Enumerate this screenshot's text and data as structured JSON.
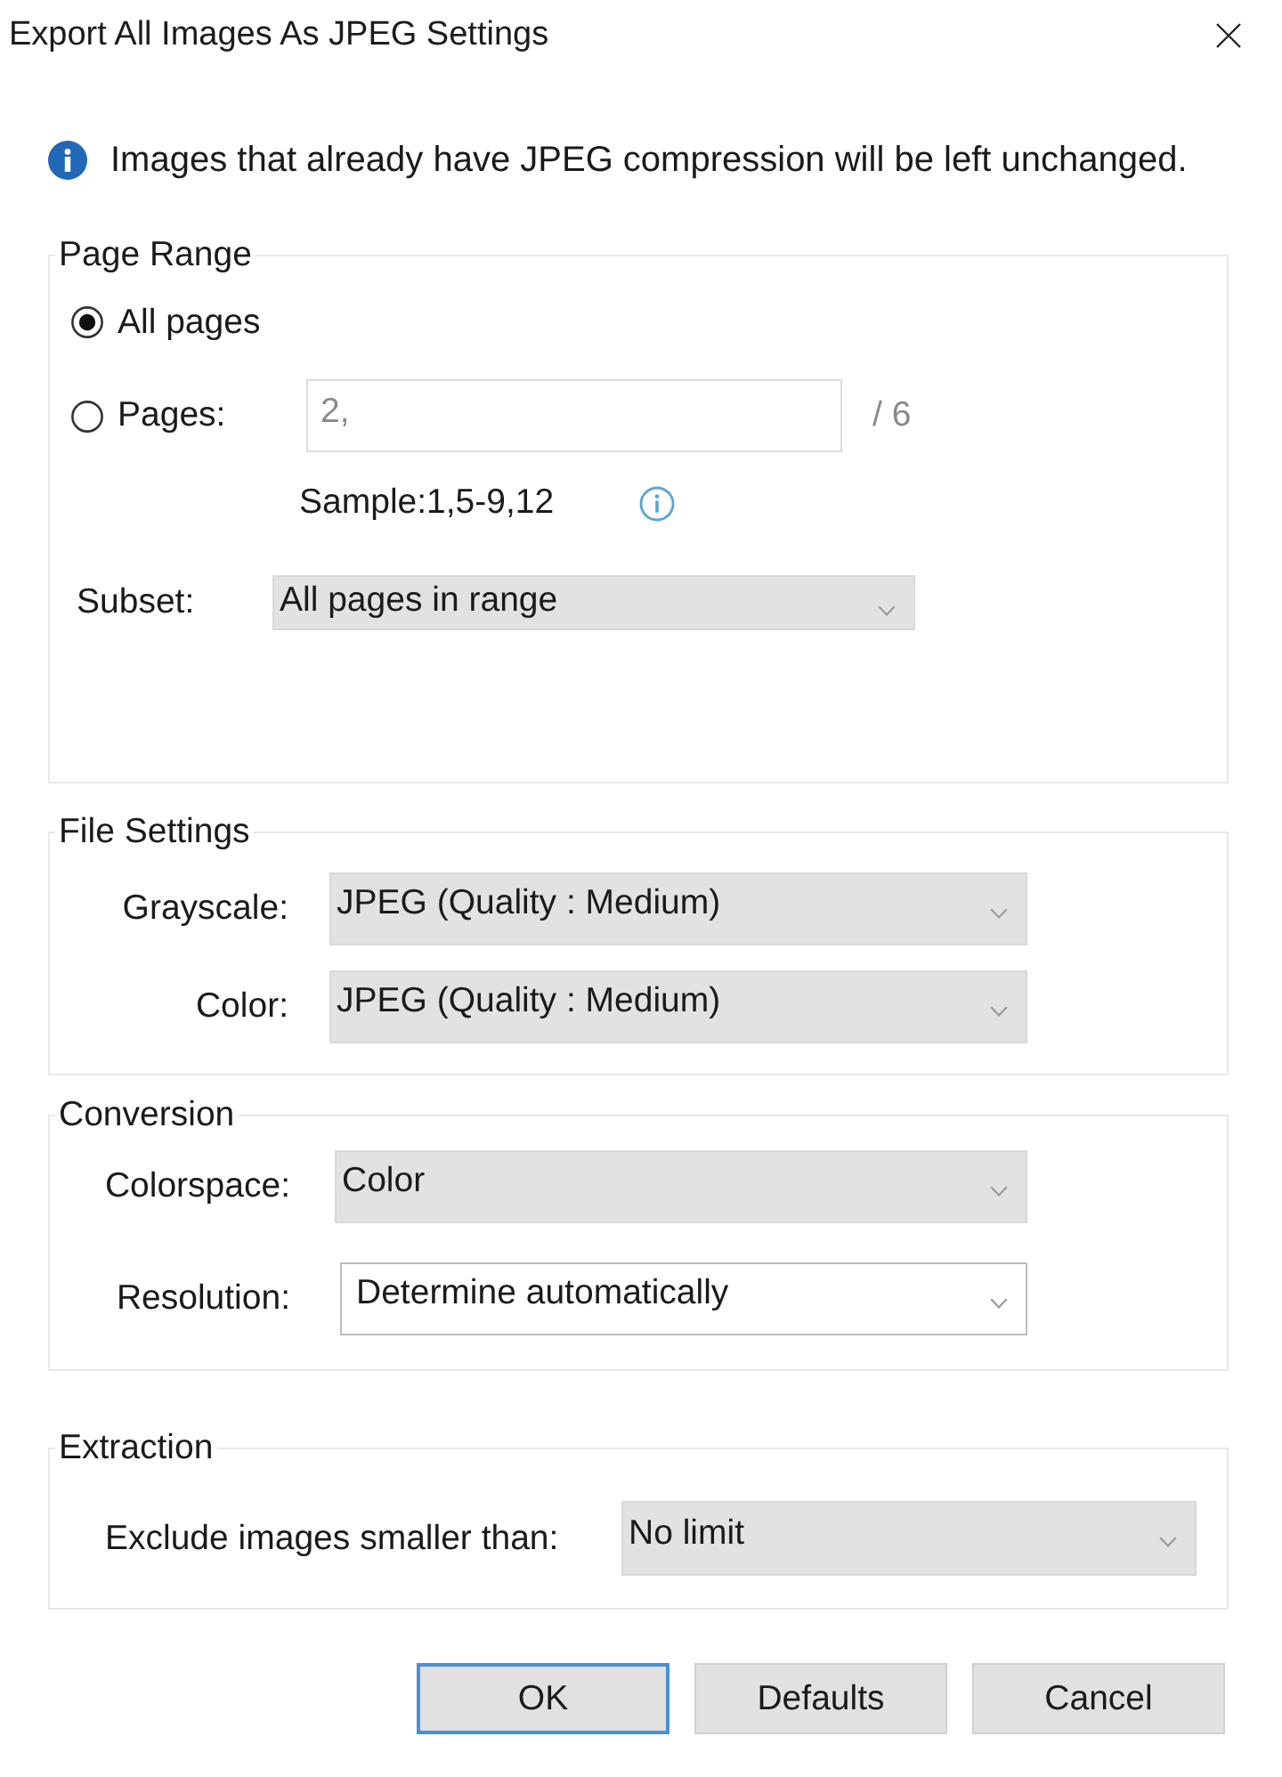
{
  "window": {
    "title": "Export All Images As JPEG Settings"
  },
  "notice": {
    "text": "Images that already have JPEG compression will be left unchanged."
  },
  "page_range": {
    "title": "Page Range",
    "options": [
      {
        "label": "All pages",
        "selected": true
      },
      {
        "label": "Pages:",
        "selected": false
      }
    ],
    "pages_field": {
      "value": "2,",
      "disabled": true
    },
    "page_count": "/ 6",
    "hint": "Sample:1,5-9,12",
    "subset": {
      "label": "Subset:",
      "value": "All pages in range",
      "kind": "list"
    }
  },
  "file_settings": {
    "title": "File Settings",
    "rows": [
      {
        "label": "Grayscale:",
        "value": "JPEG (Quality : Medium)",
        "kind": "list"
      },
      {
        "label": "Color:",
        "value": "JPEG (Quality : Medium)",
        "kind": "list"
      }
    ]
  },
  "conversion": {
    "title": "Conversion",
    "rows": [
      {
        "label": "Colorspace:",
        "value": "Color",
        "kind": "list"
      },
      {
        "label": "Resolution:",
        "value": "Determine automatically",
        "kind": "editable"
      }
    ]
  },
  "extraction": {
    "title": "Extraction",
    "rows": [
      {
        "label": "Exclude images smaller than:",
        "value": "No limit",
        "kind": "list"
      }
    ]
  },
  "buttons": [
    {
      "label": "OK",
      "default": true
    },
    {
      "label": "Defaults",
      "default": false
    },
    {
      "label": "Cancel",
      "default": false
    }
  ]
}
